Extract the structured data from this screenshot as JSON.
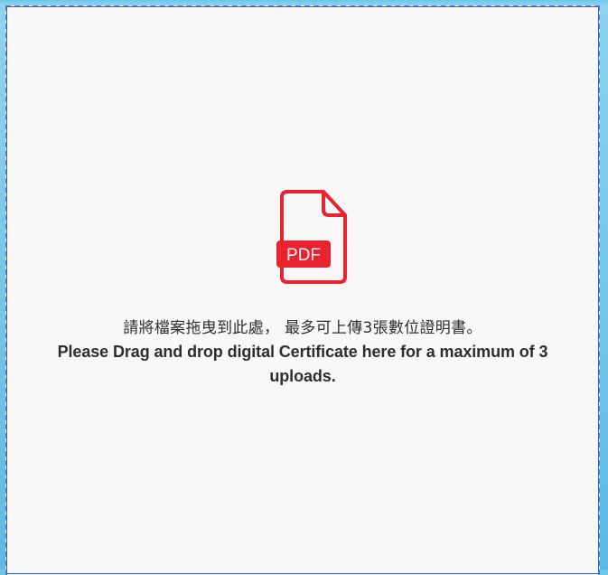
{
  "dropzone": {
    "icon": "pdf-file-icon",
    "icon_label": "PDF",
    "instruction_zh": "請將檔案拖曳到此處， 最多可上傳3張數位證明書。",
    "instruction_en": "Please Drag and drop digital Certificate here for a maximum of 3 uploads."
  },
  "colors": {
    "icon_red": "#e8232f",
    "border_blue": "#5d7fd6",
    "background": "#f8f8f9",
    "text": "#2e2e2e"
  }
}
